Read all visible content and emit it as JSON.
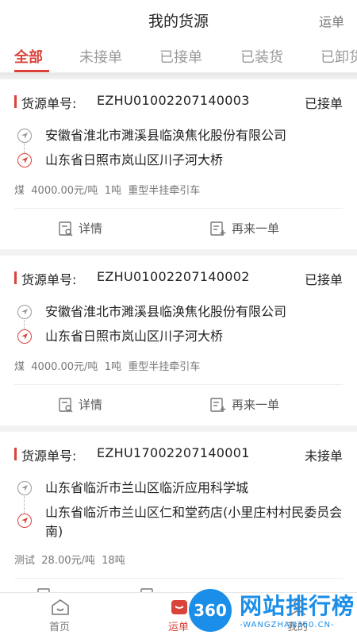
{
  "header": {
    "title": "我的货源",
    "right_link": "运单"
  },
  "tabs": [
    {
      "label": "全部",
      "active": true
    },
    {
      "label": "未接单",
      "active": false
    },
    {
      "label": "已接单",
      "active": false
    },
    {
      "label": "已装货",
      "active": false
    },
    {
      "label": "已卸货",
      "active": false
    }
  ],
  "cards": [
    {
      "order_label": "货源单号:",
      "order_no": "EZHU01002207140003",
      "status": "已接单",
      "from": "安徽省淮北市濉溪县临涣焦化股份有限公司",
      "to": "山东省日照市岚山区川子河大桥",
      "goods": "煤",
      "price": "4000.00元/吨",
      "weight": "1吨",
      "truck": "重型半挂牵引车",
      "detail_label": "详情",
      "again_label": "再来一单"
    },
    {
      "order_label": "货源单号:",
      "order_no": "EZHU01002207140002",
      "status": "已接单",
      "from": "安徽省淮北市濉溪县临涣焦化股份有限公司",
      "to": "山东省日照市岚山区川子河大桥",
      "goods": "煤",
      "price": "4000.00元/吨",
      "weight": "1吨",
      "truck": "重型半挂牵引车",
      "detail_label": "详情",
      "again_label": "再来一单"
    },
    {
      "order_label": "货源单号:",
      "order_no": "EZHU17002207140001",
      "status": "未接单",
      "from": "山东省临沂市兰山区临沂应用科学城",
      "to": "山东省临沂市兰山区仁和堂药店(小里庄村村民委员会南)",
      "goods": "测试",
      "price": "28.00元/吨",
      "weight": "18吨",
      "truck": "",
      "detail_label": "详情",
      "again_label": "再来一单"
    }
  ],
  "tabbar": {
    "home": "首页",
    "waybill": "运单",
    "mine": "我的"
  },
  "watermark": {
    "badge": "360",
    "text": "网站排行榜",
    "sub": "-WANGZHAN360.CN-"
  },
  "colors": {
    "accent": "#d9433a",
    "watermark": "#1a8ee8"
  }
}
